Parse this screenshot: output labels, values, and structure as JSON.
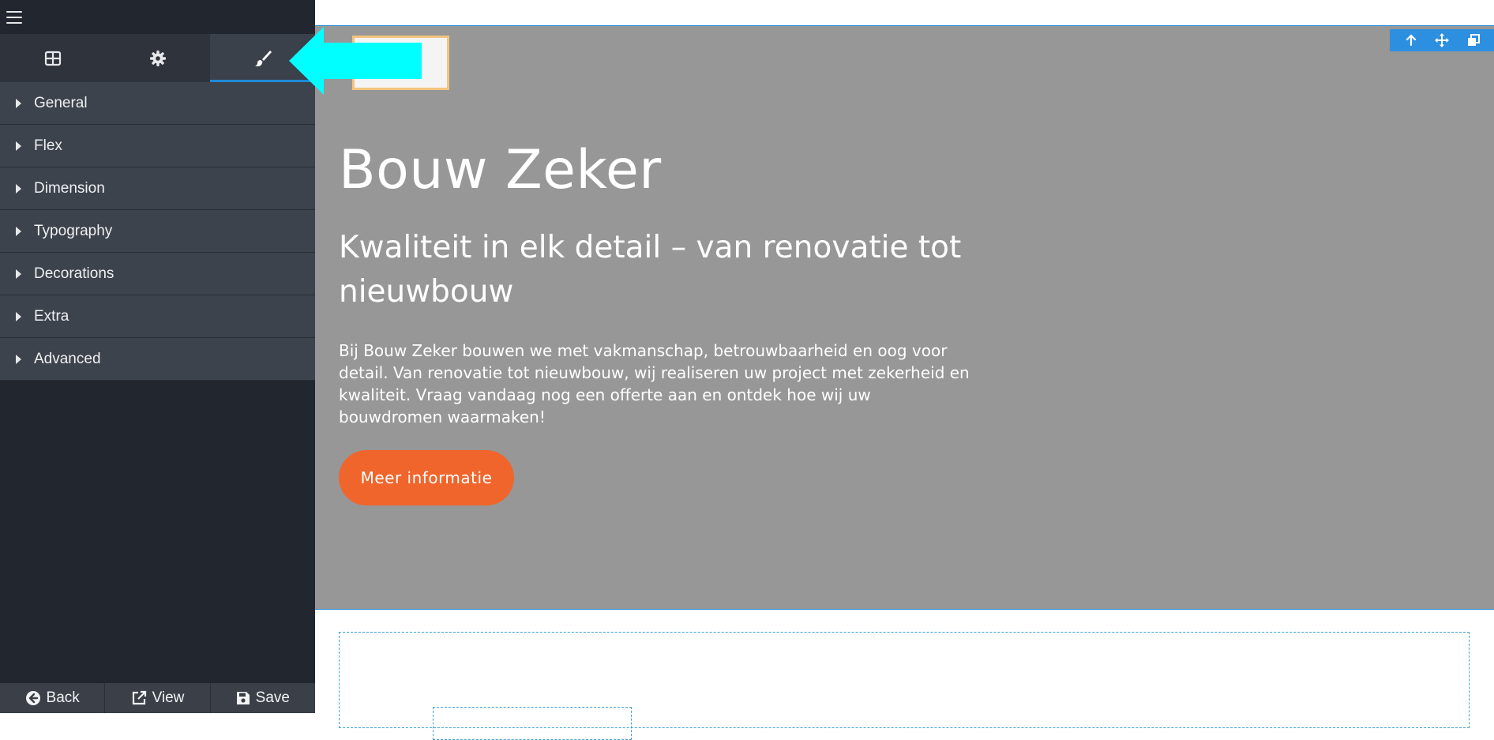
{
  "sidebar": {
    "tabs": [
      {
        "name": "layout",
        "icon": "grid-icon"
      },
      {
        "name": "settings",
        "icon": "gear-icon"
      },
      {
        "name": "style",
        "icon": "brush-icon",
        "active": true
      }
    ],
    "panels": [
      {
        "label": "General"
      },
      {
        "label": "Flex"
      },
      {
        "label": "Dimension"
      },
      {
        "label": "Typography"
      },
      {
        "label": "Decorations"
      },
      {
        "label": "Extra"
      },
      {
        "label": "Advanced"
      }
    ],
    "footer": {
      "back_label": "Back",
      "view_label": "View",
      "save_label": "Save"
    }
  },
  "hero": {
    "title": "Bouw Zeker",
    "subtitle": "Kwaliteit in elk detail – van renovatie tot nieuwbouw",
    "body": "Bij Bouw Zeker bouwen we met vakmanschap, betrouwbaarheid en oog voor detail. Van renovatie tot nieuwbouw, wij realiseren uw project met zekerheid en kwaliteit. Vraag vandaag nog een offerte aan en ontdek hoe wij uw bouwdromen waarmaken!",
    "button_label": "Meer informatie"
  },
  "colors": {
    "sidebar_bg": "#22262e",
    "panel_bg": "#3d434c",
    "accent_blue": "#1f8ad6",
    "hero_bg": "#979797",
    "cta_orange": "#f0652c",
    "annotation_arrow": "#00ffff"
  }
}
